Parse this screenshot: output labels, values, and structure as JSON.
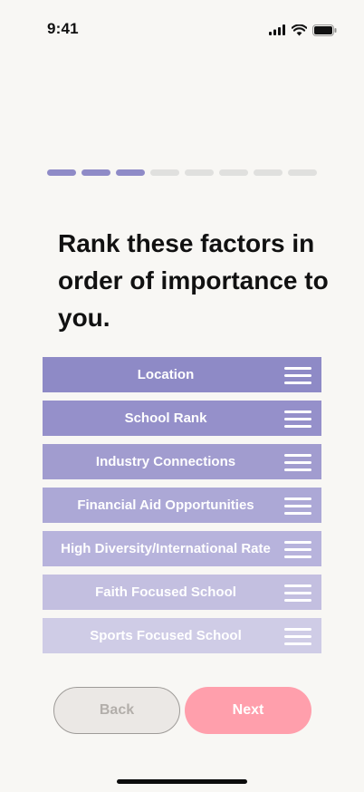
{
  "status_bar": {
    "time": "9:41",
    "icons": [
      "signal-icon",
      "wifi-icon",
      "battery-icon"
    ]
  },
  "progress": {
    "total_steps": 8,
    "completed_steps": 3,
    "active_color": "#8f8bc7",
    "inactive_color": "#e0e0de"
  },
  "heading": "Rank these factors in order of importance to you.",
  "rank_items": [
    {
      "label": "Location",
      "color": "#8e8ac6"
    },
    {
      "label": "School Rank",
      "color": "#9590ca"
    },
    {
      "label": "Industry Connections",
      "color": "#a19ccf"
    },
    {
      "label": "Financial Aid Opportunities",
      "color": "#aca8d6"
    },
    {
      "label": "High Diversity/International Rate",
      "color": "#b7b3dc"
    },
    {
      "label": "Faith Focused School",
      "color": "#c3bfe0"
    },
    {
      "label": "Sports Focused School",
      "color": "#cfcce6"
    }
  ],
  "buttons": {
    "back": "Back",
    "next": "Next"
  },
  "colors": {
    "background": "#f8f7f4",
    "next_button": "#ff9fac",
    "back_button": "#ebe8e5"
  }
}
